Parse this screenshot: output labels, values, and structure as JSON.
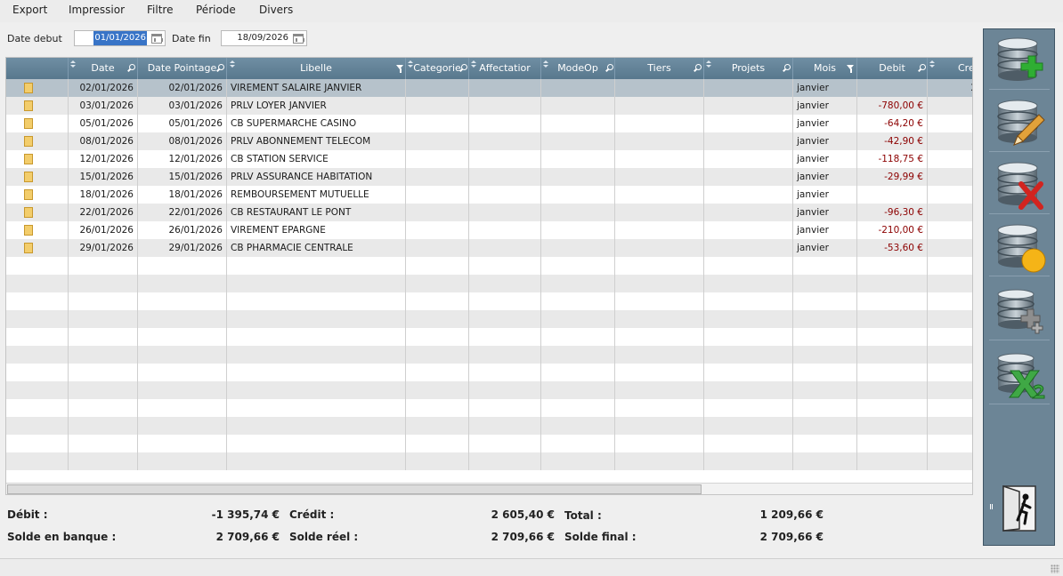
{
  "menu": [
    "Export",
    "Impressior",
    "Filtre",
    "Période",
    "Divers"
  ],
  "filters": {
    "date_debut_label": "Date debut",
    "date_debut_value": "01/01/2026",
    "date_fin_label": "Date fin",
    "date_fin_value": "18/09/2026"
  },
  "columns": [
    "",
    "Date",
    "Date Pointage",
    "Libelle",
    "Categorie",
    "Affectatior",
    "ModeOp",
    "Tiers",
    "Projets",
    "Mois",
    "Debit",
    "Cre"
  ],
  "rows": [
    {
      "date": "02/01/2026",
      "date_pointage": "02/01/2026",
      "libelle": "VIREMENT SALAIRE JANVIER",
      "mois": "janvier",
      "debit": "",
      "credit": "2"
    },
    {
      "date": "03/01/2026",
      "date_pointage": "03/01/2026",
      "libelle": "PRLV LOYER JANVIER",
      "mois": "janvier",
      "debit": "-780,00 €",
      "credit": ""
    },
    {
      "date": "05/01/2026",
      "date_pointage": "05/01/2026",
      "libelle": "CB SUPERMARCHE CASINO",
      "mois": "janvier",
      "debit": "-64,20 €",
      "credit": ""
    },
    {
      "date": "08/01/2026",
      "date_pointage": "08/01/2026",
      "libelle": "PRLV ABONNEMENT TELECOM",
      "mois": "janvier",
      "debit": "-42,90 €",
      "credit": ""
    },
    {
      "date": "12/01/2026",
      "date_pointage": "12/01/2026",
      "libelle": "CB STATION SERVICE",
      "mois": "janvier",
      "debit": "-118,75 €",
      "credit": ""
    },
    {
      "date": "15/01/2026",
      "date_pointage": "15/01/2026",
      "libelle": "PRLV ASSURANCE HABITATION",
      "mois": "janvier",
      "debit": "-29,99 €",
      "credit": ""
    },
    {
      "date": "18/01/2026",
      "date_pointage": "18/01/2026",
      "libelle": "REMBOURSEMENT MUTUELLE",
      "mois": "janvier",
      "debit": "",
      "credit": ""
    },
    {
      "date": "22/01/2026",
      "date_pointage": "22/01/2026",
      "libelle": "CB RESTAURANT LE PONT",
      "mois": "janvier",
      "debit": "-96,30 €",
      "credit": ""
    },
    {
      "date": "26/01/2026",
      "date_pointage": "26/01/2026",
      "libelle": "VIREMENT EPARGNE",
      "mois": "janvier",
      "debit": "-210,00 €",
      "credit": ""
    },
    {
      "date": "29/01/2026",
      "date_pointage": "29/01/2026",
      "libelle": "CB PHARMACIE CENTRALE",
      "mois": "janvier",
      "debit": "-53,60 €",
      "credit": ""
    }
  ],
  "summary": {
    "debit_label": "Débit :",
    "debit_value": "-1 395,74 €",
    "credit_label": "Crédit :",
    "credit_value": "2 605,40 €",
    "total_label": "Total :",
    "total_value": "1 209,66 €",
    "solde_banque_label": "Solde en banque :",
    "solde_banque_value": "2 709,66 €",
    "solde_reel_label": "Solde réel :",
    "solde_reel_value": "2 709,66 €",
    "solde_final_label": "Solde final :",
    "solde_final_value": "2 709,66 €"
  },
  "toolbar_icons": [
    "database-add-icon",
    "database-edit-icon",
    "database-delete-icon",
    "database-status-icon",
    "database-duplicate-icon",
    "database-excel-export-icon",
    "exit-door-icon"
  ],
  "colors": {
    "debit": "#8c0000",
    "header": "#6f8ea3",
    "toolbar": "#6c8596",
    "selected_row": "#b6c2cb"
  }
}
